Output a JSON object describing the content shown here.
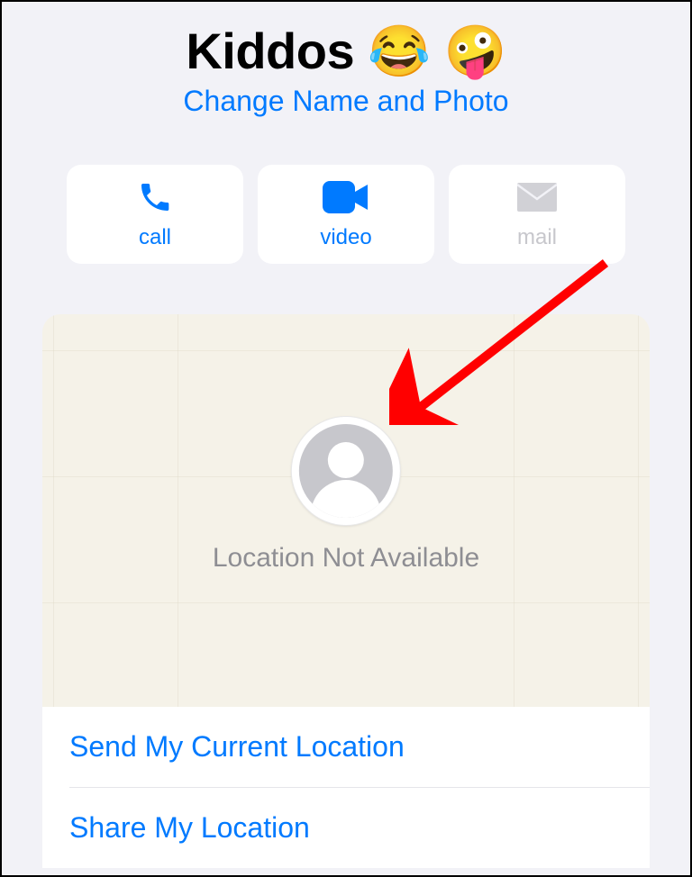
{
  "header": {
    "title": "Kiddos 😂 🤪",
    "subtitle": "Change Name and Photo"
  },
  "actions": {
    "call": "call",
    "video": "video",
    "mail": "mail"
  },
  "map": {
    "status": "Location Not Available"
  },
  "list": {
    "send_current": "Send My Current Location",
    "share": "Share My Location"
  },
  "colors": {
    "accent": "#007aff",
    "bg": "#f2f2f7",
    "disabled": "#c7c7cc",
    "muted": "#8e8e93"
  }
}
